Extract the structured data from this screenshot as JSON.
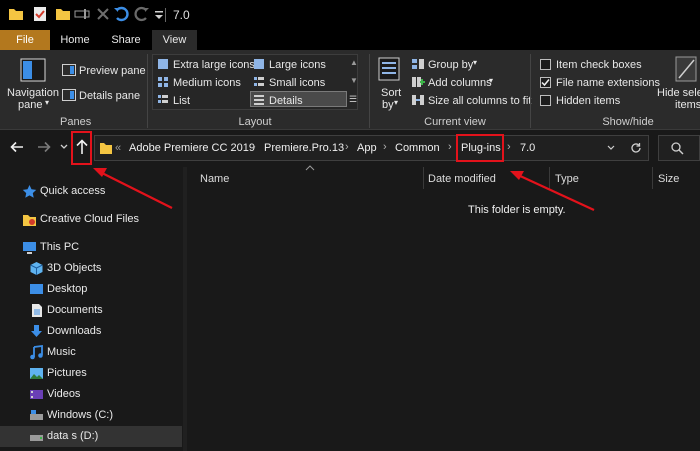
{
  "window": {
    "title": "7.0"
  },
  "ribbon_tabs": {
    "file": "File",
    "home": "Home",
    "share": "Share",
    "view": "View"
  },
  "ribbon": {
    "panes": {
      "group_label": "Panes",
      "navigation_pane_line1": "Navigation",
      "navigation_pane_line2": "pane",
      "preview_pane": "Preview pane",
      "details_pane": "Details pane"
    },
    "layout": {
      "group_label": "Layout",
      "extra_large_icons": "Extra large icons",
      "large_icons": "Large icons",
      "medium_icons": "Medium icons",
      "small_icons": "Small icons",
      "list": "List",
      "details": "Details"
    },
    "current_view": {
      "group_label": "Current view",
      "sort_line1": "Sort",
      "sort_line2": "by",
      "group_by": "Group by",
      "add_columns": "Add columns",
      "size_all_columns": "Size all columns to fit"
    },
    "show_hide": {
      "group_label": "Show/hide",
      "item_check_boxes": "Item check boxes",
      "file_name_extensions": "File name extensions",
      "hidden_items": "Hidden items",
      "hide_selected_line1": "Hide selec",
      "hide_selected_line2": "items",
      "item_check_boxes_checked": false,
      "file_name_extensions_checked": true,
      "hidden_items_checked": false
    }
  },
  "address": {
    "overflow": "«",
    "crumbs": [
      "Adobe Premiere CC 2019",
      "Premiere.Pro.13",
      "App",
      "Common",
      "Plug-ins",
      "7.0"
    ],
    "separator": "›"
  },
  "nav_pane": {
    "items": [
      {
        "label": "Quick access",
        "icon": "star-icon"
      },
      {
        "label": "Creative Cloud Files",
        "icon": "creative-cloud-folder-icon"
      },
      {
        "label": "This PC",
        "icon": "computer-icon"
      },
      {
        "label": "3D Objects",
        "icon": "3d-objects-icon"
      },
      {
        "label": "Desktop",
        "icon": "desktop-icon"
      },
      {
        "label": "Documents",
        "icon": "documents-icon"
      },
      {
        "label": "Downloads",
        "icon": "downloads-icon"
      },
      {
        "label": "Music",
        "icon": "music-icon"
      },
      {
        "label": "Pictures",
        "icon": "pictures-icon"
      },
      {
        "label": "Videos",
        "icon": "videos-icon"
      },
      {
        "label": "Windows (C:)",
        "icon": "drive-icon"
      },
      {
        "label": "data s (D:)",
        "icon": "drive-icon"
      }
    ]
  },
  "file_list": {
    "columns": {
      "name": "Name",
      "date_modified": "Date modified",
      "type": "Type",
      "size": "Size"
    },
    "empty_message": "This folder is empty."
  },
  "colors": {
    "file_tab": "#b3781e",
    "annotation_red": "#e3121b",
    "folder_yellow": "#f4c542",
    "selected_bg": "#4a4a4a"
  }
}
